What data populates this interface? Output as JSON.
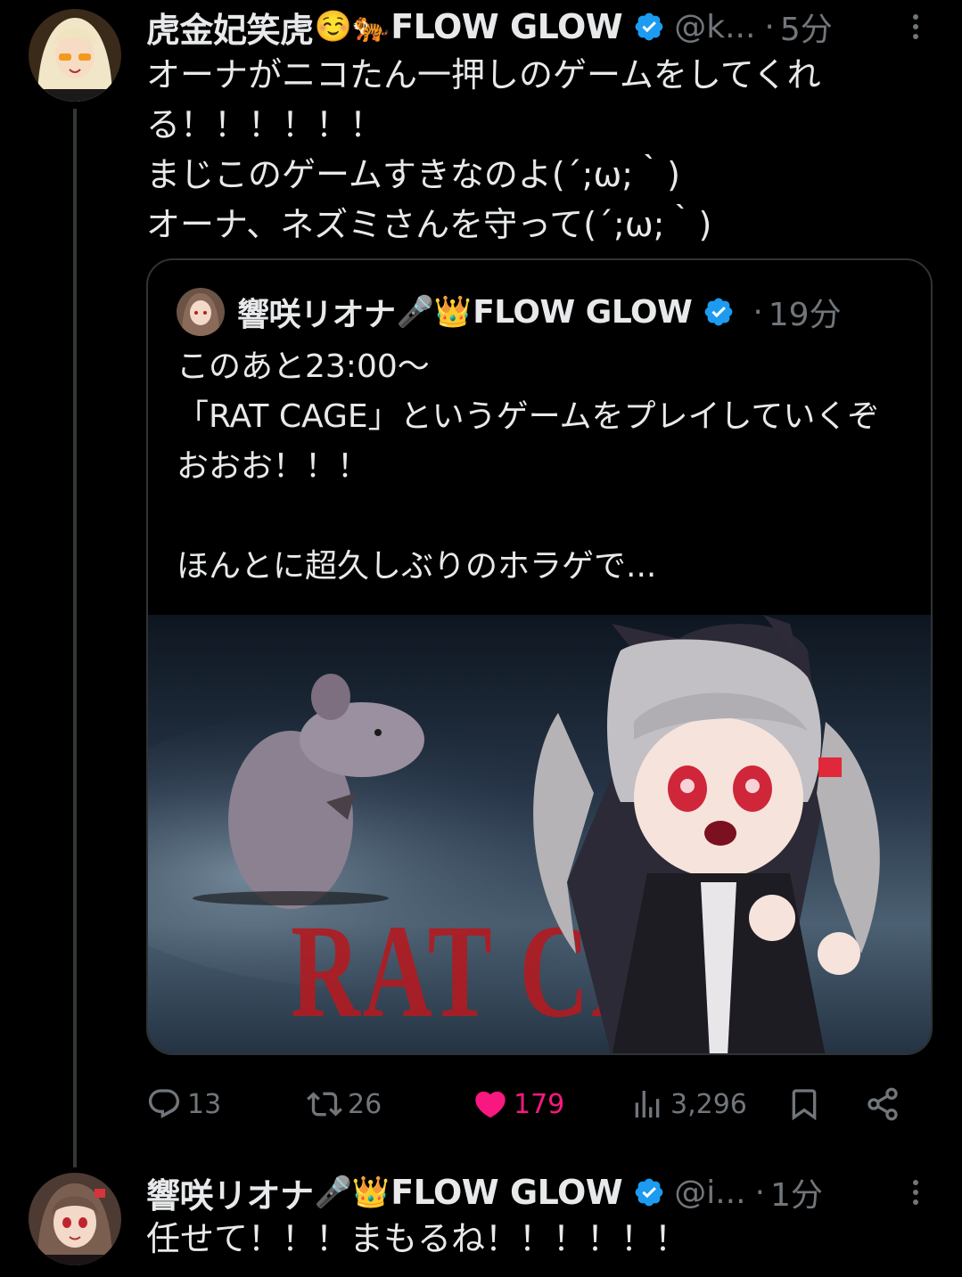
{
  "tweet1": {
    "display_name": "虎金妃笑虎",
    "name_emojis": "☺️🐅",
    "name_suffix": "FLOW GLOW",
    "handle": "@k...",
    "dot": "·",
    "time": "5分",
    "text": "オーナがニコたん一押しのゲームをしてくれる！！！！！！\nまじこのゲームすきなのよ(´;ω;｀)\nオーナ、ネズミさんを守って(´;ω;｀)"
  },
  "quote": {
    "display_name": "響咲リオナ",
    "name_emojis": "🎤👑",
    "name_suffix": "FLOW GLOW",
    "dot": "·",
    "time": "19分",
    "text": "このあと23:00〜\n「RAT CAGE」というゲームをプレイしていくぞおおお！！！\n\nほんとに超久しぶりのホラゲで...",
    "media_logo_text": "RAT CAGE"
  },
  "actions": {
    "replies": "13",
    "retweets": "26",
    "likes": "179",
    "views": "3,296"
  },
  "tweet2": {
    "display_name": "響咲リオナ",
    "name_emojis": "🎤👑",
    "name_suffix": "FLOW GLOW",
    "handle": "@i...",
    "dot": "·",
    "time": "1分",
    "text": "任せて！！！まもるね！！！！！！"
  },
  "colors": {
    "background": "#000000",
    "text": "#e7e9ea",
    "muted": "#71767b",
    "verified": "#1d9bf0",
    "like": "#f91880",
    "border": "#2f3336"
  }
}
